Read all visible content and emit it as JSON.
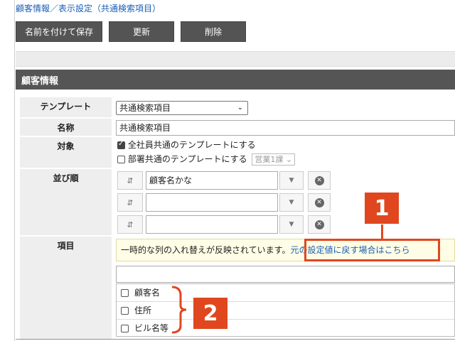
{
  "breadcrumb": "顧客情報／表示設定（共通検索項目）",
  "toolbar": {
    "save_as_label": "名前を付けて保存",
    "update_label": "更新",
    "delete_label": "削除"
  },
  "section": {
    "title": "顧客情報"
  },
  "form": {
    "template": {
      "label": "テンプレート",
      "selected": "共通検索項目"
    },
    "name": {
      "label": "名称",
      "value": "共通検索項目"
    },
    "target": {
      "label": "対象",
      "option_all": {
        "label": "全社員共通のテンプレートにする",
        "checked": true
      },
      "option_dept": {
        "label": "部署共通のテンプレートにする",
        "checked": false,
        "dept_select": "営業1課"
      }
    },
    "sort_order": {
      "label": "並び順",
      "rows": [
        {
          "value": "顧客名かな"
        },
        {
          "value": ""
        },
        {
          "value": ""
        }
      ]
    },
    "items": {
      "label": "項目",
      "notice_text": "一時的な列の入れ替えが反映されています。",
      "notice_link": "元の設定値に戻す場合はこちら",
      "search_value": "",
      "list": [
        {
          "label": "顧客名",
          "checked": false
        },
        {
          "label": "住所",
          "checked": false
        },
        {
          "label": "ビル名等",
          "checked": false
        }
      ]
    }
  },
  "annotations": {
    "badge1": "1",
    "badge2": "2",
    "color": "#e0471f"
  },
  "icons": {
    "sort": "sort-icon",
    "dropdown": "chevron-down-icon",
    "clear": "close-circle-icon"
  }
}
